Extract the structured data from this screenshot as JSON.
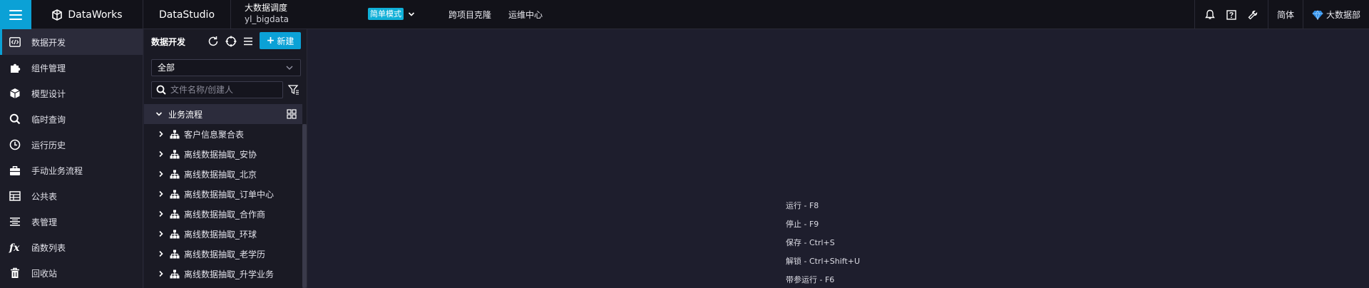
{
  "topbar": {
    "brand": "DataWorks",
    "studio": "DataStudio",
    "project_name": "大数据调度",
    "project_id": "yl_bigdata",
    "mode_label": "简单模式",
    "links": [
      "跨项目克隆",
      "运维中心"
    ],
    "language": "简体",
    "user": "大数据部",
    "icons": [
      "bell-icon",
      "help-icon",
      "wrench-icon"
    ]
  },
  "leftnav": {
    "items": [
      {
        "label": "数据开发",
        "icon": "code-icon",
        "active": true
      },
      {
        "label": "组件管理",
        "icon": "puzzle-icon",
        "active": false
      },
      {
        "label": "模型设计",
        "icon": "cube-icon",
        "active": false
      },
      {
        "label": "临时查询",
        "icon": "search-icon",
        "active": false
      },
      {
        "label": "运行历史",
        "icon": "clock-icon",
        "active": false
      },
      {
        "label": "手动业务流程",
        "icon": "briefcase-icon",
        "active": false
      },
      {
        "label": "公共表",
        "icon": "table-icon",
        "active": false
      },
      {
        "label": "表管理",
        "icon": "list-icon",
        "active": false
      },
      {
        "label": "函数列表",
        "icon": "function-icon",
        "active": false
      },
      {
        "label": "回收站",
        "icon": "trash-icon",
        "active": false
      }
    ]
  },
  "tree": {
    "title": "数据开发",
    "new_button": "新建",
    "filter_value": "全部",
    "search_placeholder": "文件名称/创建人",
    "root_label": "业务流程",
    "nodes": [
      "客户信息聚合表",
      "离线数据抽取_安协",
      "离线数据抽取_北京",
      "离线数据抽取_订单中心",
      "离线数据抽取_合作商",
      "离线数据抽取_环球",
      "离线数据抽取_老学历",
      "离线数据抽取_升学业务"
    ]
  },
  "main": {
    "shortcuts": [
      "运行 - F8",
      "停止 - F9",
      "保存 - Ctrl+S",
      "解锁 - Ctrl+Shift+U",
      "带参运行 - F6"
    ]
  },
  "colors": {
    "accent": "#0ba1d6",
    "topbar_bg": "#121219",
    "panel_bg": "#1c1c27",
    "editor_bg": "#1e1e2d"
  }
}
